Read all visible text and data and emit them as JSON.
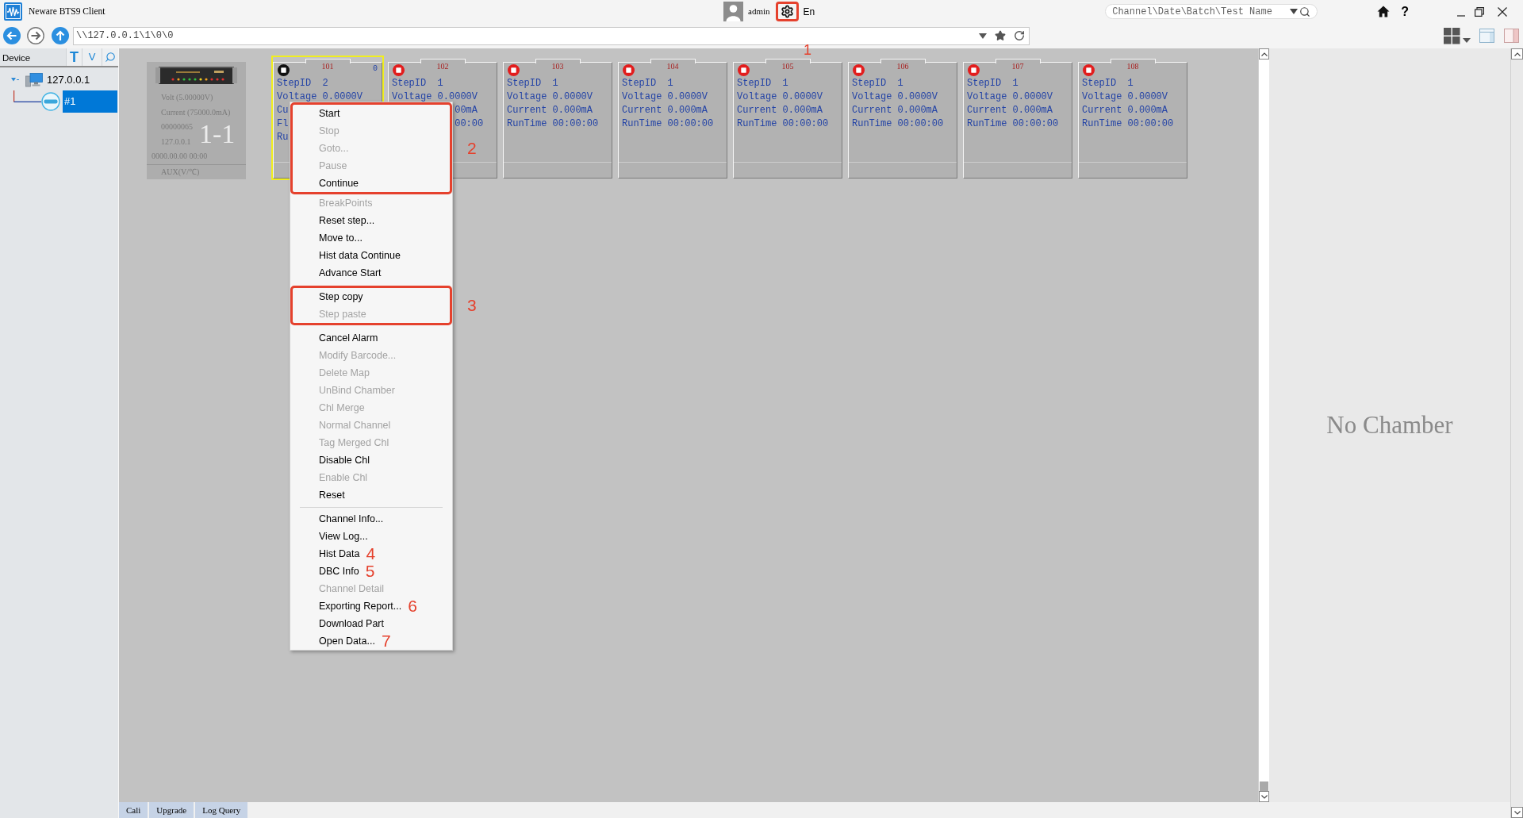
{
  "window": {
    "title": "Neware BTS9 Client",
    "user": "admin",
    "language": "En",
    "help_label": "?",
    "settings_callout": "1"
  },
  "search": {
    "placeholder": "Channel\\Date\\Batch\\Test Name"
  },
  "address_bar": {
    "path": "\\\\127.0.0.1\\1\\0\\0"
  },
  "device_panel": {
    "title": "Device",
    "tool_buttons": [
      "T",
      "V"
    ],
    "tree": [
      {
        "label": "127.0.0.1",
        "expanded": true,
        "selected": false,
        "children": [
          {
            "label": "#1",
            "selected": true
          }
        ]
      }
    ]
  },
  "device_card": {
    "unit_label": "1-1",
    "lines": [
      "Volt (5.00000V)",
      "Current (75000.0mA)",
      "00000065",
      "127.0.0.1"
    ],
    "timestamp": "0000.00.00 00:00",
    "footer": "AUX(V/℃)"
  },
  "channels": [
    {
      "number": "101",
      "selected": true,
      "color": "#111111",
      "badge": "0",
      "rows": [
        {
          "label": "StepID",
          "value": "2"
        },
        {
          "label": "Voltage",
          "value": "0.0000V"
        },
        {
          "label": "Cu"
        },
        {
          "label": "Fl"
        },
        {
          "label": "Ru"
        }
      ]
    },
    {
      "number": "102",
      "selected": false,
      "color": "#e21d1d",
      "rows": [
        {
          "label": "StepID",
          "value": "1"
        },
        {
          "label": "Voltage",
          "value": "0.0000V"
        },
        {
          "value": "00mA"
        },
        {
          "value": "00:00"
        }
      ]
    },
    {
      "number": "103",
      "selected": false,
      "color": "#e21d1d",
      "rows": [
        {
          "label": "StepID",
          "value": "1"
        },
        {
          "label": "Voltage",
          "value": "0.0000V"
        },
        {
          "label": "Current",
          "value": "0.000mA"
        },
        {
          "label": "RunTime",
          "value": "00:00:00"
        }
      ]
    },
    {
      "number": "104",
      "selected": false,
      "color": "#e21d1d",
      "rows": [
        {
          "label": "StepID",
          "value": "1"
        },
        {
          "label": "Voltage",
          "value": "0.0000V"
        },
        {
          "label": "Current",
          "value": "0.000mA"
        },
        {
          "label": "RunTime",
          "value": "00:00:00"
        }
      ]
    },
    {
      "number": "105",
      "selected": false,
      "color": "#e21d1d",
      "rows": [
        {
          "label": "StepID",
          "value": "1"
        },
        {
          "label": "Voltage",
          "value": "0.0000V"
        },
        {
          "label": "Current",
          "value": "0.000mA"
        },
        {
          "label": "RunTime",
          "value": "00:00:00"
        }
      ]
    },
    {
      "number": "106",
      "selected": false,
      "color": "#e21d1d",
      "rows": [
        {
          "label": "StepID",
          "value": "1"
        },
        {
          "label": "Voltage",
          "value": "0.0000V"
        },
        {
          "label": "Current",
          "value": "0.000mA"
        },
        {
          "label": "RunTime",
          "value": "00:00:00"
        }
      ]
    },
    {
      "number": "107",
      "selected": false,
      "color": "#e21d1d",
      "rows": [
        {
          "label": "StepID",
          "value": "1"
        },
        {
          "label": "Voltage",
          "value": "0.0000V"
        },
        {
          "label": "Current",
          "value": "0.000mA"
        },
        {
          "label": "RunTime",
          "value": "00:00:00"
        }
      ]
    },
    {
      "number": "108",
      "selected": false,
      "color": "#e21d1d",
      "rows": [
        {
          "label": "StepID",
          "value": "1"
        },
        {
          "label": "Voltage",
          "value": "0.0000V"
        },
        {
          "label": "Current",
          "value": "0.000mA"
        },
        {
          "label": "RunTime",
          "value": "00:00:00"
        }
      ]
    }
  ],
  "context_menu": {
    "groups": [
      {
        "separated": false,
        "callout": "2",
        "items": [
          {
            "label": "Start",
            "disabled": false
          },
          {
            "label": "Stop",
            "disabled": true
          },
          {
            "label": "Goto...",
            "disabled": true
          },
          {
            "label": "Pause",
            "disabled": true
          },
          {
            "label": "Continue",
            "disabled": false
          }
        ]
      },
      {
        "separated": false,
        "items": [
          {
            "label": "BreakPoints",
            "disabled": true
          },
          {
            "label": "Reset step...",
            "disabled": false
          },
          {
            "label": "Move to...",
            "disabled": false
          },
          {
            "label": "Hist data Continue",
            "disabled": false
          },
          {
            "label": "Advance Start",
            "disabled": false
          }
        ]
      },
      {
        "separated": true,
        "callout": "3",
        "items": [
          {
            "label": "Step copy",
            "disabled": false
          },
          {
            "label": "Step paste",
            "disabled": true
          }
        ]
      },
      {
        "separated": true,
        "items": [
          {
            "label": "Cancel Alarm",
            "disabled": false
          },
          {
            "label": "Modify Barcode...",
            "disabled": true
          },
          {
            "label": "Delete Map",
            "disabled": true
          },
          {
            "label": "UnBind Chamber",
            "disabled": true
          },
          {
            "label": "Chl Merge",
            "disabled": true
          },
          {
            "label": "Normal Channel",
            "disabled": true
          },
          {
            "label": "Tag Merged Chl",
            "disabled": true
          },
          {
            "label": "Disable Chl",
            "disabled": false
          },
          {
            "label": "Enable Chl",
            "disabled": true
          },
          {
            "label": "Reset",
            "disabled": false
          }
        ]
      },
      {
        "separated": true,
        "items": [
          {
            "label": "Channel Info...",
            "disabled": false
          },
          {
            "label": "View Log...",
            "disabled": false
          },
          {
            "label": "Hist Data",
            "disabled": false,
            "callout": "4"
          },
          {
            "label": "DBC Info",
            "disabled": false,
            "callout": "5"
          },
          {
            "label": "Channel Detail",
            "disabled": true
          },
          {
            "label": "Exporting Report...",
            "disabled": false,
            "callout": "6"
          },
          {
            "label": "Download Part",
            "disabled": false
          },
          {
            "label": "Open Data...",
            "disabled": false,
            "callout": "7"
          }
        ]
      }
    ]
  },
  "chamber_panel": {
    "message": "No Chamber"
  },
  "bottom_tabs": [
    "Cali",
    "Upgrade",
    "Log Query"
  ]
}
